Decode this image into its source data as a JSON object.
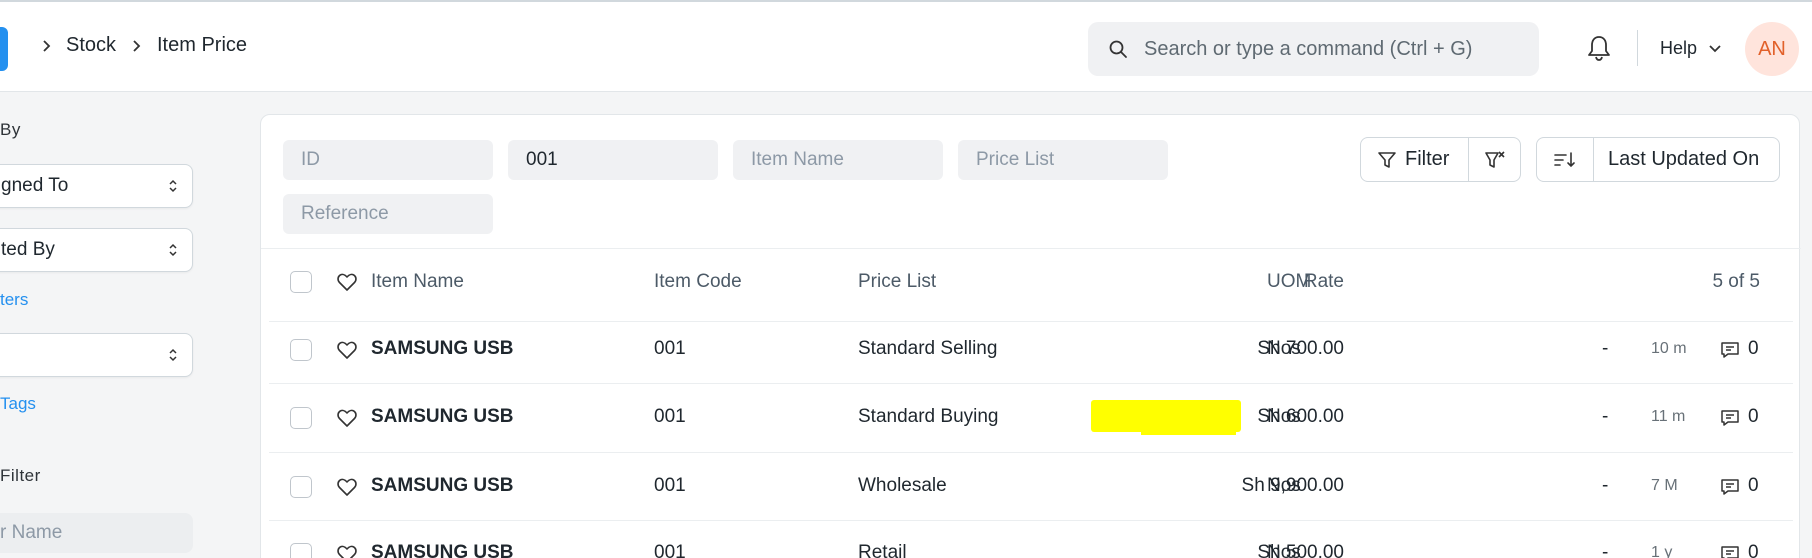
{
  "breadcrumb": {
    "items": [
      "Stock",
      "Item Price"
    ]
  },
  "search": {
    "placeholder": "Search or type a command (Ctrl + G)"
  },
  "header": {
    "help_label": "Help",
    "avatar_initials": "AN"
  },
  "sidebar": {
    "group_by_label": "By",
    "assigned_to": "gned To",
    "created_by": "ted By",
    "edit_filters_link": "ters",
    "tags_select": "",
    "show_tags_link": "Tags",
    "save_filter_label": "Filter",
    "filter_name_placeholder": "r Name"
  },
  "filters": {
    "id_placeholder": "ID",
    "item_code_value": "001",
    "item_name_placeholder": "Item Name",
    "price_list_placeholder": "Price List",
    "reference_placeholder": "Reference"
  },
  "toolbar": {
    "filter_label": "Filter",
    "sort_label": "Last Updated On"
  },
  "table": {
    "columns": {
      "item_name": "Item Name",
      "item_code": "Item Code",
      "price_list": "Price List",
      "rate": "Rate",
      "uom": "UOM"
    },
    "count": "5 of 5",
    "rows": [
      {
        "item_name": "SAMSUNG USB",
        "item_code": "001",
        "price_list": "Standard Selling",
        "rate": "Sh 700.00",
        "uom": "Nos",
        "dash": "-",
        "modified": "10 m",
        "comments": "0"
      },
      {
        "item_name": "SAMSUNG USB",
        "item_code": "001",
        "price_list": "Standard Buying",
        "rate": "Sh 600.00",
        "uom": "Nos",
        "dash": "-",
        "modified": "11 m",
        "comments": "0"
      },
      {
        "item_name": "SAMSUNG USB",
        "item_code": "001",
        "price_list": "Wholesale",
        "rate": "Sh 9,900.00",
        "uom": "Nos",
        "dash": "-",
        "modified": "7 M",
        "comments": "0"
      },
      {
        "item_name": "SAMSUNG USB",
        "item_code": "001",
        "price_list": "Retail",
        "rate": "Sh 500.00",
        "uom": "Nos",
        "dash": "-",
        "modified": "1 y",
        "comments": "0"
      }
    ]
  },
  "colors": {
    "accent": "#2490ef",
    "highlight": "#ffff00",
    "avatar_bg": "#ffe4dc",
    "avatar_fg": "#e2612b"
  }
}
